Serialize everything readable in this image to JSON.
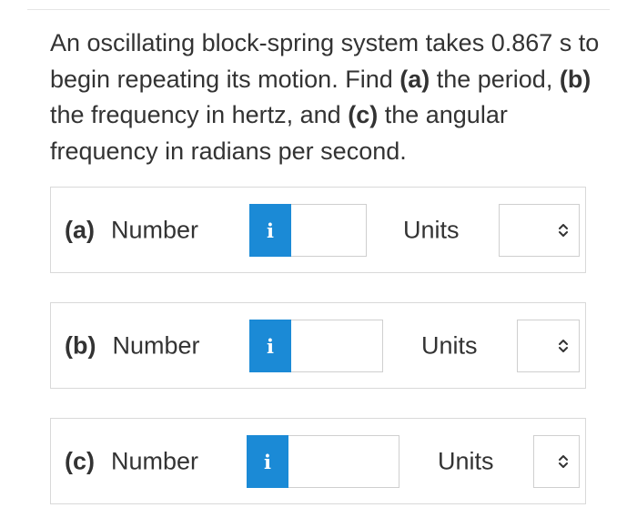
{
  "question": {
    "segments": [
      {
        "text": "An oscillating block-spring system takes 0.867 s to begin repeating its motion. Find ",
        "bold": false
      },
      {
        "text": "(a)",
        "bold": true
      },
      {
        "text": " the period, ",
        "bold": false
      },
      {
        "text": "(b)",
        "bold": true
      },
      {
        "text": " the frequency in hertz, and ",
        "bold": false
      },
      {
        "text": "(c)",
        "bold": true
      },
      {
        "text": " the angular frequency in radians per second.",
        "bold": false
      }
    ]
  },
  "parts": [
    {
      "letter": "(a)",
      "number_label": "Number",
      "info_icon": "i",
      "number_value": "",
      "units_label": "Units",
      "units_value": ""
    },
    {
      "letter": "(b)",
      "number_label": "Number",
      "info_icon": "i",
      "number_value": "",
      "units_label": "Units",
      "units_value": ""
    },
    {
      "letter": "(c)",
      "number_label": "Number",
      "info_icon": "i",
      "number_value": "",
      "units_label": "Units",
      "units_value": ""
    }
  ],
  "colors": {
    "info_button": "#1b8ad6",
    "text": "#333333",
    "border": "#d9d9d9"
  },
  "icons": {
    "info": "info-icon",
    "select": "chevron-up-down-icon"
  }
}
